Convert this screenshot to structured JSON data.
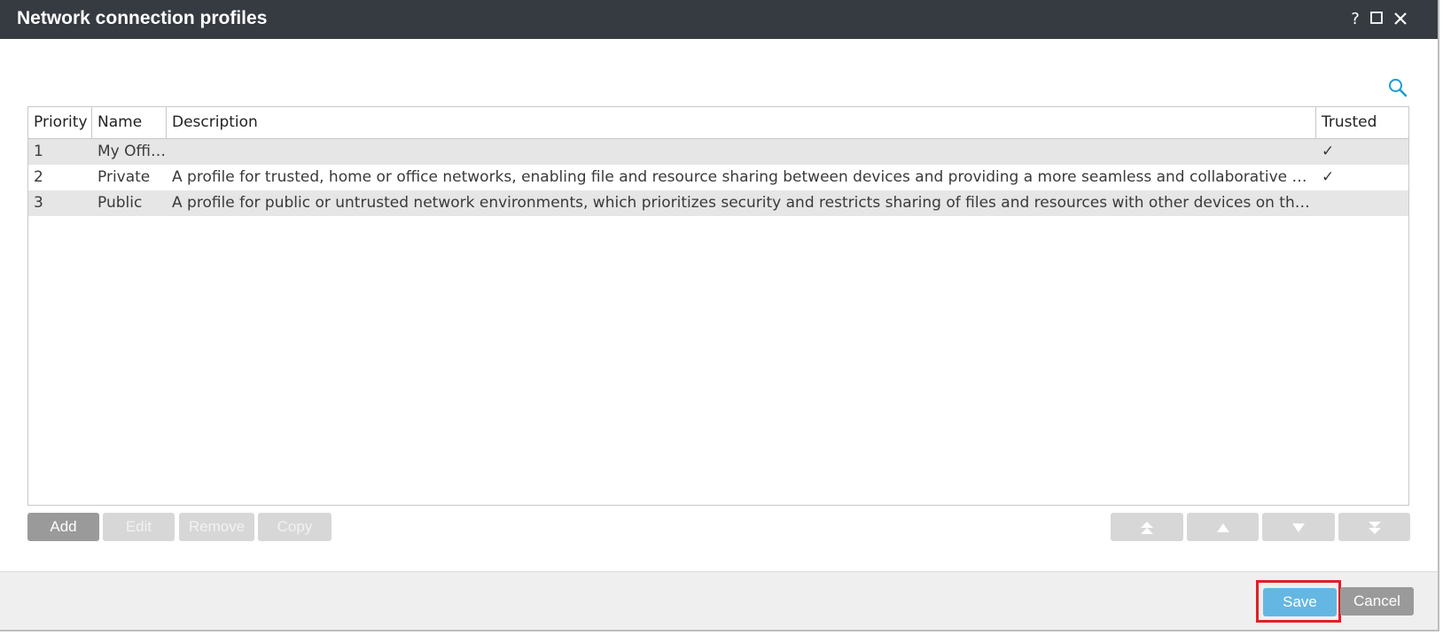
{
  "window": {
    "title": "Network connection profiles",
    "help_label": "?",
    "maximize_label": "☐",
    "close_label": "✕"
  },
  "toolbar": {
    "search_icon": "search-icon"
  },
  "table": {
    "columns": [
      "Priority",
      "Name",
      "Description",
      "Trusted"
    ],
    "rows": [
      {
        "priority": "1",
        "name": "My Office",
        "description": "",
        "trusted": "✓"
      },
      {
        "priority": "2",
        "name": "Private",
        "description": "A profile for trusted, home or office networks, enabling file and resource sharing between devices and providing a more seamless and collaborative network exper...",
        "trusted": "✓"
      },
      {
        "priority": "3",
        "name": "Public",
        "description": "A profile for public or untrusted network environments, which prioritizes security and restricts sharing of files and resources with other devices on the networ...",
        "trusted": ""
      }
    ]
  },
  "actions": {
    "add": "Add",
    "edit": "Edit",
    "remove": "Remove",
    "copy": "Copy"
  },
  "order_buttons": {
    "top": "⇞",
    "up": "▲",
    "down": "▼",
    "bottom": "⇟"
  },
  "footer": {
    "save": "Save",
    "cancel": "Cancel"
  },
  "colors": {
    "titlebar": "#363a41",
    "save_accent": "#64b7e2",
    "highlight": "#e31e24"
  }
}
